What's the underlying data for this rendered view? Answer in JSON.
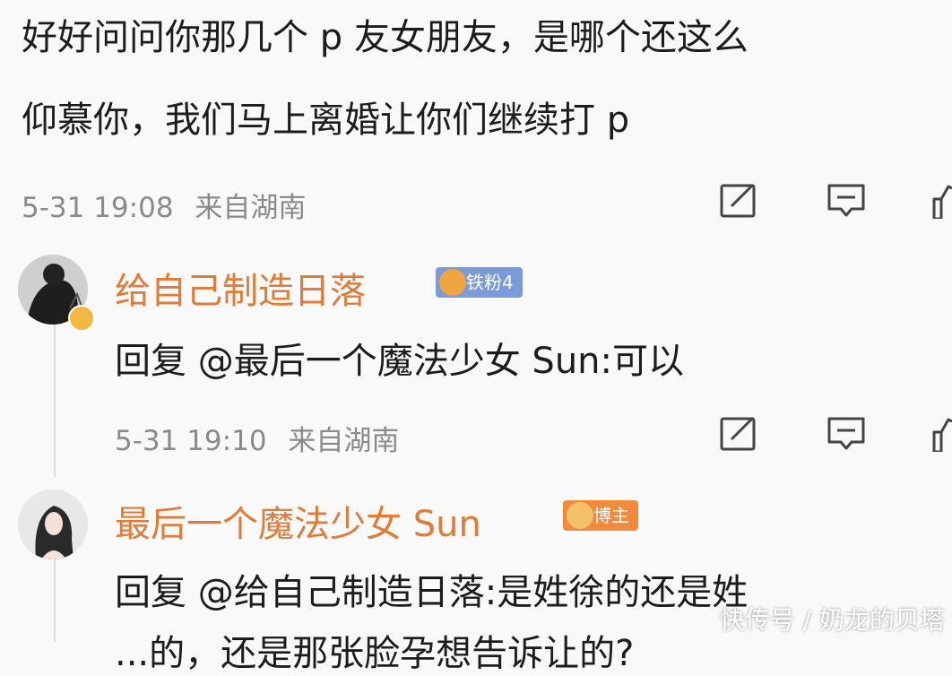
{
  "post": {
    "line1": "好好问问你那几个 p 友女朋友，是哪个还这么",
    "line2": "仰慕你，我们马上离婚让你们继续打 p",
    "timestamp": "5-31 19:08",
    "source": "来自湖南"
  },
  "comments": [
    {
      "username": "给自己制造日落",
      "badge_label": "铁粉4",
      "reply_prefix": "回复 ",
      "mention": "@最后一个魔法少女 Sun",
      "reply_text": ":可以",
      "timestamp": "5-31 19:10",
      "source": "来自湖南"
    },
    {
      "username": "最后一个魔法少女 Sun",
      "badge_label": "博主",
      "reply_prefix": "回复 ",
      "mention": "@给自己制造日落",
      "reply_text": ":是姓徐的还是姓",
      "reply_line2": "...的，还是那张脸孕想告诉让的?"
    }
  ],
  "icons": [
    "edit-icon",
    "comment-icon",
    "like-icon"
  ],
  "watermark": "快传号 / 奶龙的贝塔",
  "colors": {
    "username": "#e07b39",
    "meta": "#8a8a8a",
    "badge_fan": "#7a9ad8",
    "badge_host": "#f08a3c",
    "background": "#f9f9f9"
  }
}
